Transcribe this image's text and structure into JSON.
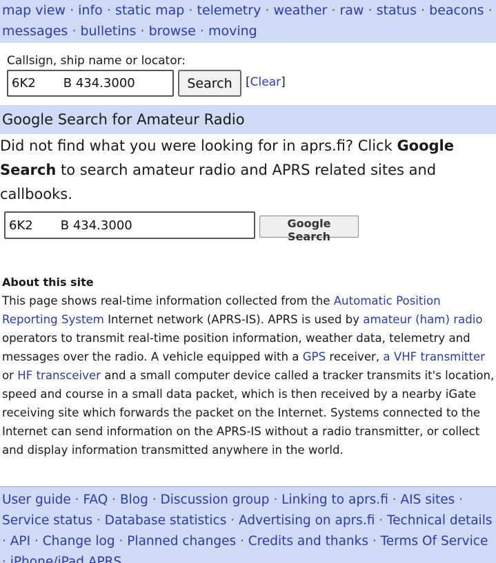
{
  "nav": {
    "items": [
      "map view",
      "info",
      "static map",
      "telemetry",
      "weather",
      "raw",
      "status",
      "beacons",
      "messages",
      "bulletins",
      "browse",
      "moving"
    ]
  },
  "search": {
    "label": "Callsign, ship name or locator:",
    "value": "6K2       B 434.3000",
    "button": "Search",
    "clear": "Clear"
  },
  "google": {
    "title": "Google Search for Amateur Radio",
    "desc_before": "Did not find what you were looking for in aprs.fi? Click ",
    "desc_bold": "Google Search",
    "desc_after": " to search amateur radio and APRS related sites and callbooks.",
    "value": "6K2       B 434.3000",
    "button": "Google Search"
  },
  "about": {
    "title": "About this site",
    "t1": "This page shows real-time information collected from the ",
    "l1": "Automatic Position Reporting System",
    "t2": " Internet network (APRS-IS). APRS is used by ",
    "l2": "amateur (ham) radio",
    "t3": " operators to transmit real-time position information, weather data, telemetry and messages over the radio. A vehicle equipped with a ",
    "l3": "GPS",
    "t4": " receiver, ",
    "l4": "a VHF transmitter",
    "t5": " or ",
    "l5": "HF transceiver",
    "t6": " and a small computer device called a tracker transmits it's location, speed and course in a small data packet, which is then received by a nearby iGate receiving site which forwards the packet on the Internet. Systems connected to the Internet can send information on the APRS-IS without a radio transmitter, or collect and display information transmitted anywhere in the world."
  },
  "footer": {
    "items": [
      "User guide",
      "FAQ",
      "Blog",
      "Discussion group",
      "Linking to aprs.fi",
      "AIS sites",
      "Service status",
      "Database statistics",
      "Advertising on aprs.fi",
      "Technical details",
      "API",
      "Change log",
      "Planned changes",
      "Credits and thanks",
      "Terms Of Service",
      "iPhone/iPad APRS"
    ]
  }
}
